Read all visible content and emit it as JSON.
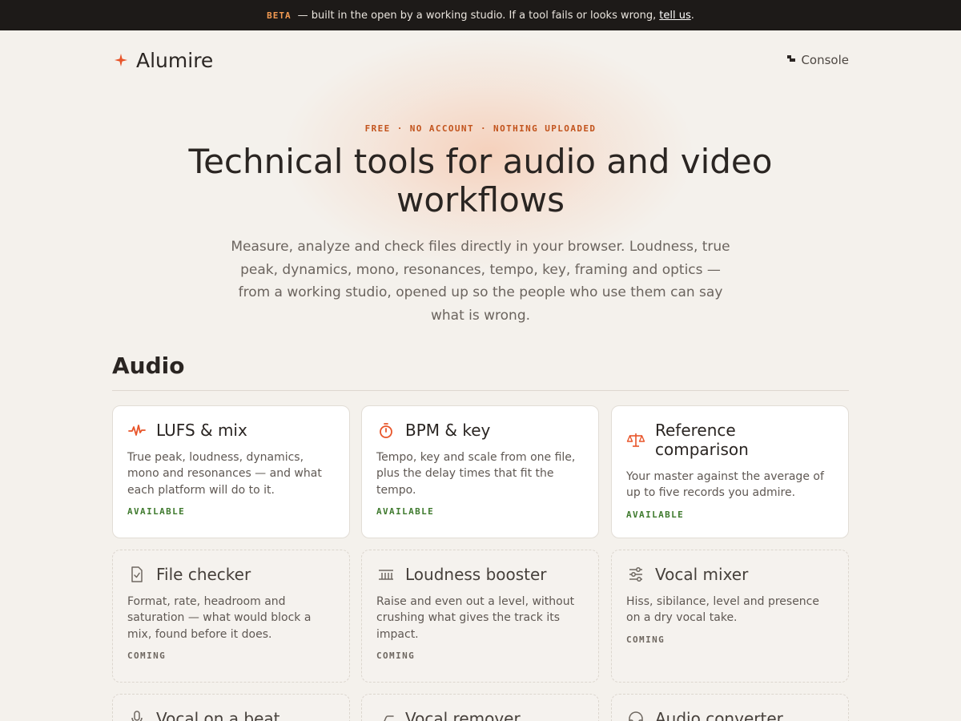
{
  "banner": {
    "badge": "BETA",
    "message": "— built in the open by a working studio. If a tool fails or looks wrong,",
    "link": "tell us",
    "period": "."
  },
  "brand": {
    "name": "Alumire",
    "icon": "sparkle-icon"
  },
  "nav": {
    "console_label": "Console",
    "console_icon": "console-icon"
  },
  "hero": {
    "eyebrow": "FREE · NO ACCOUNT · NOTHING UPLOADED",
    "title": "Technical tools for audio and video workflows",
    "lede": "Measure, analyze and check files directly in your browser. Loudness, true peak, dynamics, mono, resonances, tempo, key, framing and optics — from a working studio, opened up so the people who use them can say what is wrong."
  },
  "section": {
    "title": "Audio"
  },
  "tools": [
    {
      "title": "LUFS & mix",
      "desc": "True peak, loudness, dynamics, mono and resonances — and what each platform will do to it.",
      "status": "AVAILABLE",
      "icon": "waveform-icon"
    },
    {
      "title": "BPM & key",
      "desc": "Tempo, key and scale from one file, plus the delay times that fit the tempo.",
      "status": "AVAILABLE",
      "icon": "stopwatch-icon"
    },
    {
      "title": "Reference comparison",
      "desc": "Your master against the average of up to five records you admire.",
      "status": "AVAILABLE",
      "icon": "scales-icon"
    },
    {
      "title": "File checker",
      "desc": "Format, rate, headroom and saturation — what would block a mix, found before it does.",
      "status": "COMING",
      "icon": "file-check-icon"
    },
    {
      "title": "Loudness booster",
      "desc": "Raise and even out a level, without crushing what gives the track its impact.",
      "status": "COMING",
      "icon": "meter-icon"
    },
    {
      "title": "Vocal mixer",
      "desc": "Hiss, sibilance, level and presence on a dry vocal take.",
      "status": "COMING",
      "icon": "sliders-icon"
    },
    {
      "title": "Vocal on a beat",
      "desc": "",
      "status": "",
      "icon": "microphone-icon"
    },
    {
      "title": "Vocal remover",
      "desc": "",
      "status": "",
      "icon": "curve-icon"
    },
    {
      "title": "Audio converter",
      "desc": "",
      "status": "",
      "icon": "headphones-icon"
    }
  ],
  "colors": {
    "accent": "#e8552a",
    "available": "#3f7a2e",
    "banner_bg": "#1d1a18"
  }
}
